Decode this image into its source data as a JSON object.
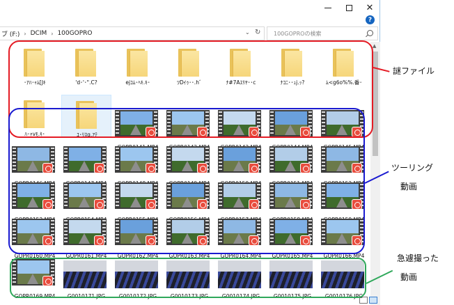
{
  "window": {
    "address_crumbs": [
      "ブ (F:)",
      "DCIM",
      "100GOPRO"
    ],
    "search_placeholder": "100GOPROの検索",
    "close_glyph": "✕"
  },
  "folders": [
    "･ｱﾊ･ｬﾑ[Jｷ",
    "'d･'･\".C?",
    "ejｺﾑ･ﾍｷ.ｷ･",
    "ﾂDｲｩ･･.hﾞ",
    "ﾅ#7Aｽﾘﾔ･･c",
    "ﾅｺﾆ･･ｭj.ｯ?",
    "ﾑ<g6o%%.番･",
    "ﾊ･ｬvﾓ.ｷ･",
    "ﾕ･ﾘｽg.ｱﾃ"
  ],
  "videos": [
    "GOPR0141.MP4",
    "GOPR0142.MP4",
    "GOPR0143.MP4",
    "GOPR0144.MP4",
    "GOPR0145.MP4",
    "GOPR0146.MP4",
    "GOPR0147.MP4",
    "GOPR0148.MP4",
    "GOPR0149.MP4",
    "GOPR0150.MP4",
    "GOPR0151.MP4",
    "GOPR0152.MP4",
    "GOPR0153.MP4",
    "GOPR0154.MP4",
    "GOPR0155.MP4",
    "GOPR0156.MP4",
    "GOPR0157.MP4",
    "GOPR0158.MP4",
    "GOPR0159.MP4",
    "GOPR0160.MP4",
    "GOPR0161.MP4",
    "GOPR0162.MP4",
    "GOPR0163.MP4",
    "GOPR0164.MP4",
    "GOPR0165.MP4",
    "GOPR0166.MP4"
  ],
  "bottom_row": [
    "GOPR0169.MP4",
    "G0010171.JPG",
    "G0010172.JPG",
    "G0010173.JPG",
    "G0010174.JPG",
    "G0010175.JPG",
    "G0010176.JPG"
  ],
  "annotations": {
    "mystery_files": "謎ファイル",
    "touring_videos_line1": "ツーリング",
    "touring_videos_line2": "動画",
    "quick_shot_line1": "急遽撮った",
    "quick_shot_line2": "動画"
  },
  "colors": {
    "red": "#e41b24",
    "blue": "#1a1ad0",
    "green": "#2fa85a"
  }
}
